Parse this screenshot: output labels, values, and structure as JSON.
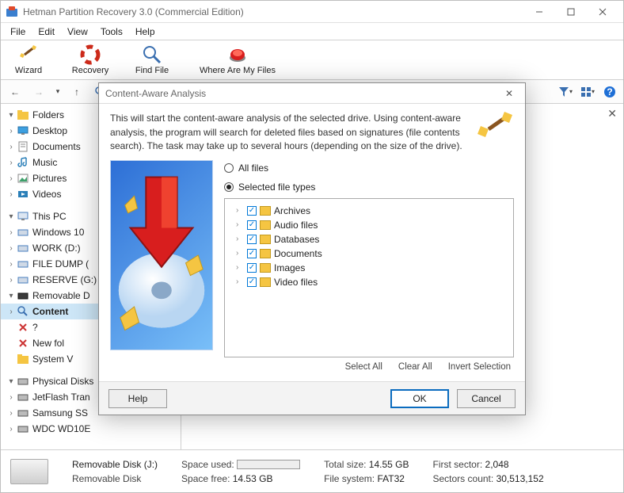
{
  "window": {
    "title": "Hetman Partition Recovery 3.0 (Commercial Edition)"
  },
  "menu": {
    "items": [
      "File",
      "Edit",
      "View",
      "Tools",
      "Help"
    ]
  },
  "toolbar": {
    "wizard": "Wizard",
    "recovery": "Recovery",
    "find_file": "Find File",
    "where": "Where Are My Files"
  },
  "tree": {
    "folders": {
      "label": "Folders",
      "children": [
        {
          "label": "Desktop"
        },
        {
          "label": "Documents"
        },
        {
          "label": "Music"
        },
        {
          "label": "Pictures"
        },
        {
          "label": "Videos"
        }
      ]
    },
    "thispc": {
      "label": "This PC",
      "children": [
        {
          "label": "Windows 10"
        },
        {
          "label": "WORK (D:)"
        },
        {
          "label": "FILE DUMP ("
        },
        {
          "label": "RESERVE (G:)"
        },
        {
          "label": "Removable D",
          "children": [
            {
              "label": "Content",
              "selected": true
            },
            {
              "label": "?"
            },
            {
              "label": "New fol"
            },
            {
              "label": "System V"
            }
          ]
        }
      ]
    },
    "physical": {
      "label": "Physical Disks",
      "children": [
        {
          "label": "JetFlash Tran"
        },
        {
          "label": "Samsung SS"
        },
        {
          "label": "WDC WD10E"
        }
      ]
    }
  },
  "dialog": {
    "title": "Content-Aware Analysis",
    "desc": "This will start the content-aware analysis of the selected drive. Using content-aware analysis, the program will search for deleted files based on signatures (file contents search). The task may take up to several hours (depending on the size of the drive).",
    "radio_all": "All files",
    "radio_sel": "Selected file types",
    "types": [
      "Archives",
      "Audio files",
      "Databases",
      "Documents",
      "Images",
      "Video files"
    ],
    "links": {
      "select_all": "Select All",
      "clear_all": "Clear All",
      "invert": "Invert Selection"
    },
    "buttons": {
      "help": "Help",
      "ok": "OK",
      "cancel": "Cancel"
    }
  },
  "status": {
    "name": "Removable Disk (J:)",
    "type": "Removable Disk",
    "space_used_label": "Space used:",
    "space_free_label": "Space free:",
    "space_free": "14.53 GB",
    "total_size_label": "Total size:",
    "total_size": "14.55 GB",
    "fs_label": "File system:",
    "fs": "FAT32",
    "first_sector_label": "First sector:",
    "first_sector": "2,048",
    "sectors_label": "Sectors count:",
    "sectors": "30,513,152"
  }
}
